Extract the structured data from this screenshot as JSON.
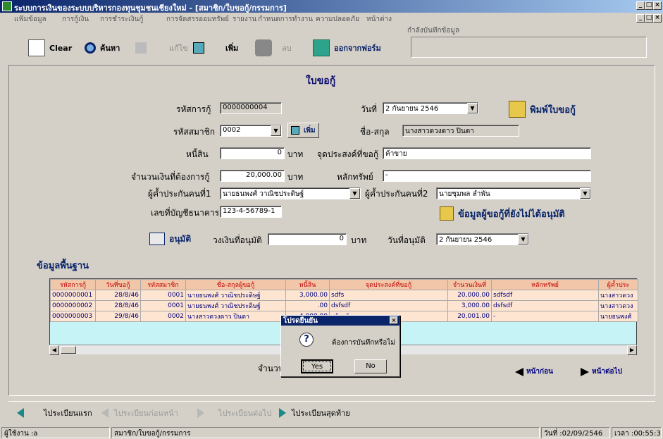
{
  "window": {
    "title": "ระบบการเงินของระบบบริหารกองทุนชุมชนเชียงใหม่ - [สมาชิก/ใบขอกู้/กรรมการ]",
    "min": "_",
    "max": "□",
    "close": "×"
  },
  "menu": {
    "items": [
      "แฟ้มข้อมูล",
      "การกู้เงิน",
      "การชำระเงินกู้",
      "การจัดสรร",
      "ออมทรัพย์",
      "รายงาน",
      "กำหนดการทำงาน",
      "ความปลอดภัย",
      "หน้าต่าง"
    ]
  },
  "infobox_label": "กำลังบันทึกข้อมูล",
  "toolbar": {
    "clear": "Clear",
    "search": "ค้นหา",
    "edit": "แก้ไข",
    "add": "เพิ่ม",
    "delete": "ลบ",
    "exit": "ออกจากฟอร์ม"
  },
  "form": {
    "title": "ใบขอกู้",
    "loan_code_label": "รหัสการกู้",
    "loan_code": "0000000004",
    "date_label": "วันที่",
    "date_value": "2  กันยายน  2546",
    "print_label": "พิมพ์ใบขอกู้",
    "member_code_label": "รหัสสมาชิก",
    "member_code": "0002",
    "add_member_label": "เพิ่ม",
    "name_label": "ชื่อ-สกุล",
    "name_value": "นางสาวดวงดาว ปินตา",
    "debt_label": "หนี้สิน",
    "debt_value": "0",
    "baht1": "บาท",
    "purpose_label": "จุดประสงค์ที่ขอกู้",
    "purpose_value": "ค้าขาย",
    "amount_label": "จำนวนเงินที่ต้องการกู้",
    "amount_value": "20,000.00",
    "baht2": "บาท",
    "collateral_label": "หลักทรัพย์",
    "collateral_value": "-",
    "guarantor1_label": "ผู้ค้ำประกันคนที่1",
    "guarantor1_value": "นายธนพงศ์ วาณิชประดิษฐ์",
    "guarantor2_label": "ผู้ค้ำประกันคนที่2",
    "guarantor2_value": "นายชุมพล ลำพัน",
    "bank_label": "เลขที่บัญชีธนาคาร",
    "bank_value": "123-4-56789-1",
    "unapproved_label": "ข้อมูลผู้ขอกู้ที่ยังไม่ได้อนุมัติ",
    "approve_label": "อนุมัติ",
    "approved_amount_label": "วงเงินที่อนุมัติ",
    "approved_amount_value": "0",
    "baht3": "บาท",
    "approve_date_label": "วันที่อนุมัติ",
    "approve_date_value": "2  กันยายน  2546"
  },
  "basic": {
    "title": "ข้อมูลพื้นฐาน",
    "headers": [
      "รหัสการกู้",
      "วันที่ขอกู้",
      "รหัสสมาชิก",
      "ชื่อ-สกุลผู้ขอกู้",
      "หนี้สิน",
      "จุดประสงค์ที่ขอกู้",
      "จำนวนเงินที่",
      "หลักทรัพย์",
      "ผู้ค้ำประ"
    ],
    "rows": [
      [
        "0000000001",
        "28/8/46",
        "0001",
        "นายธนพงศ์ วาณิชประดิษฐ์",
        "3,000.00",
        "sdfs",
        "20,000.00",
        "sdfsdf",
        "นางสาวดวง"
      ],
      [
        "0000000002",
        "28/8/46",
        "0001",
        "นายธนพงศ์ วาณิชประดิษฐ์",
        ".00",
        "dsfsdf",
        "3,000.00",
        "dsfsdf",
        "นางสาวดวง"
      ],
      [
        "0000000003",
        "29/8/46",
        "0002",
        "นางสาวดวงดาว ปินตา",
        "4,000.00",
        "สร้างบ้าน",
        "20,001.00",
        "-",
        "นายธนพงศ์"
      ]
    ],
    "count_label": "จำนวน",
    "prev_page": "หน้าก่อน",
    "next_page": "หน้าต่อไป"
  },
  "dialog": {
    "title": "โปรดยืนยัน",
    "message": "ต้องการบันทึกหรือไม่",
    "yes": "Yes",
    "no": "No",
    "close": "×"
  },
  "nav": {
    "first": "ไประเบียนแรก",
    "prev": "ไประเบียนก่อนหน้า",
    "next": "ไประเบียนต่อไป",
    "last": "ไประเบียนสุดท้าย"
  },
  "status": {
    "user": "ผู้ใช้งาน :a",
    "form": "สมาชิก/ใบขอกู้/กรรมการ",
    "date": "วันที่ :02/09/2546",
    "time": "เวลา :00:55:32"
  }
}
